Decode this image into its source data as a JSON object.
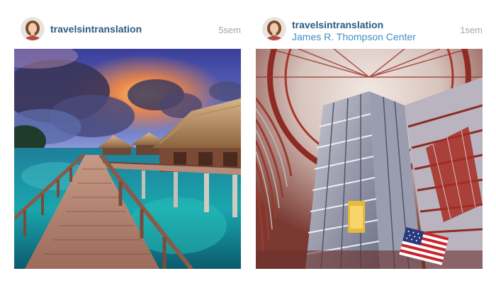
{
  "posts": [
    {
      "username": "travelsintranslation",
      "location": "",
      "timestamp": "5sem",
      "photo_subject": "overwater-bungalows-at-sunset"
    },
    {
      "username": "travelsintranslation",
      "location": "James R. Thompson Center",
      "timestamp": "1sem",
      "photo_subject": "atrium-with-american-flag"
    }
  ],
  "colors": {
    "username": "#2b5a82",
    "location": "#3f8fc2",
    "timestamp": "#a6a6a6"
  }
}
